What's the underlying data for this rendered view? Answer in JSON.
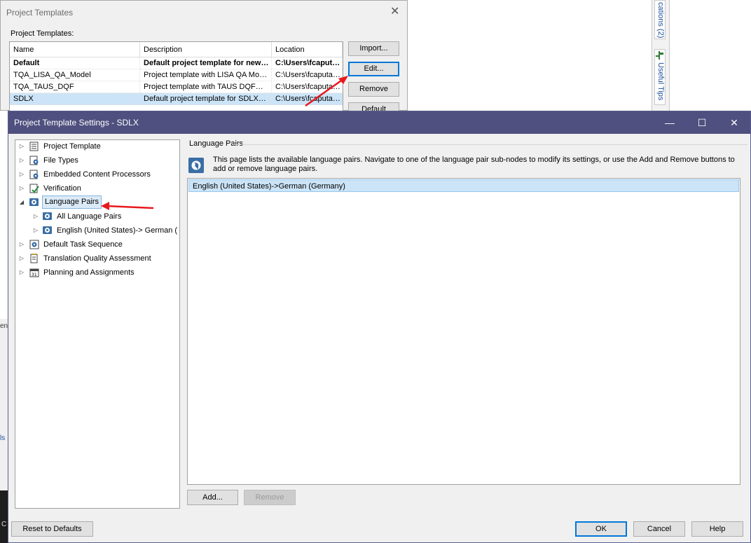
{
  "background": {
    "right_tabs": [
      "cations (2)",
      "Useful Tips"
    ],
    "left_fragments": [
      "en",
      "ls",
      "C"
    ]
  },
  "templates_dialog": {
    "title": "Project Templates",
    "label": "Project Templates:",
    "columns": [
      "Name",
      "Description",
      "Location"
    ],
    "rows": [
      {
        "name": "Default",
        "description": "Default project template for new…",
        "location": "C:\\Users\\fcaput…"
      },
      {
        "name": "TQA_LISA_QA_Model",
        "description": "Project template with LISA QA Mo…",
        "location": "C:\\Users\\fcaputa…"
      },
      {
        "name": "TQA_TAUS_DQF",
        "description": "Project template with TAUS DQF…",
        "location": "C:\\Users\\fcaputa…"
      },
      {
        "name": "SDLX",
        "description": "Default project template for SDLX…",
        "location": "C:\\Users\\fcaputa…"
      }
    ],
    "buttons": {
      "import": "Import...",
      "edit": "Edit...",
      "remove": "Remove",
      "default": "Default"
    }
  },
  "settings_dialog": {
    "title": "Project Template Settings - SDLX",
    "window_controls": {
      "minimize": "—",
      "maximize": "☐",
      "close": "✕"
    },
    "tree": {
      "project_template": "Project Template",
      "file_types": "File Types",
      "embedded": "Embedded Content Processors",
      "verification": "Verification",
      "language_pairs": "Language Pairs",
      "all_language_pairs": "All Language Pairs",
      "english_german": "English (United States)-> German (",
      "default_task_sequence": "Default Task Sequence",
      "tqa": "Translation Quality Assessment",
      "planning": "Planning and Assignments"
    },
    "content": {
      "header": "Language Pairs",
      "info": "This page lists the available language pairs. Navigate to one of the language pair sub-nodes to modify its settings, or use the Add and Remove buttons to add or remove language pairs.",
      "pairs": [
        "English (United States)->German (Germany)"
      ],
      "add": "Add...",
      "remove": "Remove"
    },
    "footer": {
      "reset": "Reset to Defaults",
      "ok": "OK",
      "cancel": "Cancel",
      "help": "Help"
    }
  },
  "colors": {
    "titlebar": "#4f507f",
    "selection": "#cce4f7",
    "annotation_arrow": "#e8191e"
  }
}
